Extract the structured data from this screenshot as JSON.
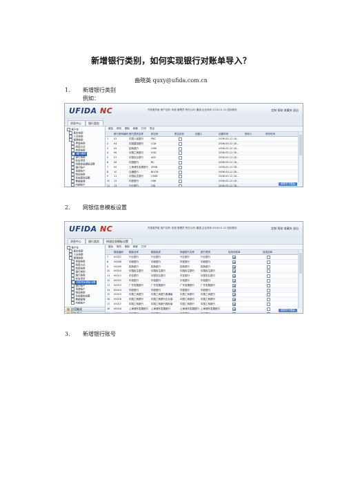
{
  "doc": {
    "title": "新增银行类别，如何实现银行对账单导入？",
    "author": "曲晓英    quxy@ufida.com.cn",
    "sections": [
      {
        "num": "1.",
        "label": "新增银行类别",
        "sub": "例如："
      },
      {
        "num": "2.",
        "label": "网银信息模板设置"
      },
      {
        "num": "3.",
        "label": "新增银行账号"
      }
    ]
  },
  "shot1": {
    "logo_a": "UFIDA ",
    "logo_b": "NC",
    "status": "开发维护组   用户名称: 系统    管理员    所在公司: 集团   企业时间 2018-01-12   回到首页",
    "tools": "定制  帮助  收藏夹  退出",
    "tabs": [
      "消息中心",
      "银行类别"
    ],
    "nav": [
      "客户化",
      "基本档案",
      "人员档案",
      "管理档案",
      "界面档案",
      "结算方式",
      "结算档案",
      "银行类别",
      "银行档案",
      "收支项目",
      "网银信息模板设置",
      "银行账户",
      "现金账户",
      "物品档案",
      "系统基础设置",
      "票据管理",
      "内部账户"
    ],
    "categories": [
      "应用集成",
      "财务会计",
      "计划预算",
      "资金管理",
      "供应链",
      "资产管理",
      "信息中心",
      "集成管理"
    ],
    "toolbar": [
      "增加",
      "修改",
      "删除",
      "刷新",
      "打印",
      "导出"
    ],
    "headers": [
      "",
      "银行类别编码",
      "银行类别名称",
      "助记码",
      "是否封存",
      "创建人",
      "创建时间",
      "修改人",
      "修改时间"
    ],
    "rows": [
      [
        "1",
        "02",
        "中国人民银行",
        "PBC",
        "",
        "",
        "2006-05-12 18...",
        ""
      ],
      [
        "2",
        "04",
        "中国建设银行",
        "CCB",
        "",
        "",
        "2006-05-12 18...",
        ""
      ],
      [
        "3",
        "05",
        "招商银行",
        "CMB",
        "",
        "",
        "2006-05-12 18...",
        ""
      ],
      [
        "4",
        "06",
        "中国工商银行",
        "ICBC",
        "",
        "",
        "2006-05-12 18...",
        ""
      ],
      [
        "5",
        "07",
        "中国农业银行",
        "ABC",
        "",
        "",
        "2006-05-12 18...",
        ""
      ],
      [
        "6",
        "08",
        "中国银行",
        "BC",
        "",
        "",
        "2006-05-12 18...",
        ""
      ],
      [
        "7",
        "09",
        "上海浦东发展银行",
        "SPDB",
        "",
        "",
        "2006-05-12 18...",
        ""
      ],
      [
        "8",
        "10",
        "交通银行",
        "BOCM",
        "",
        "",
        "2006-05-12 18...",
        ""
      ],
      [
        "9",
        "11",
        "中国民生银行",
        "CMBC",
        "",
        "",
        "2006-05-12 18...",
        ""
      ],
      [
        "10",
        "12",
        "华夏银行",
        "HXB",
        "",
        "",
        "2006-05-12 18...",
        ""
      ],
      [
        "11",
        "13",
        "兴业银行",
        "CIB",
        "",
        "",
        "2006-05-12 18...",
        ""
      ],
      [
        "12",
        "14",
        "日本瑞穗银行",
        "",
        "",
        "",
        "2006-05-12 18...",
        ""
      ],
      [
        "13",
        "15",
        "广东发展银行",
        "GDB",
        "",
        "",
        "2006-05-12 18...",
        ""
      ],
      [
        "14",
        "16",
        "北京银行",
        "BOB",
        "",
        "",
        "2006-05-12 18...",
        ""
      ],
      [
        "15",
        "17",
        "日本三菱银行",
        "",
        "",
        "",
        "2006-05-12 18...",
        ""
      ],
      [
        "16",
        "18",
        "国家开发银行",
        "CDB",
        "",
        "",
        "2006-05-12 18...",
        ""
      ],
      [
        "17",
        "19",
        "中信银行",
        "CNCB",
        "",
        "",
        "2006-05-12 18...",
        ""
      ],
      [
        "18",
        "20",
        "香港汇丰银行",
        "HSBC",
        "",
        "",
        "2006-05-12 18...",
        ""
      ],
      [
        "19",
        "99",
        "民生银行",
        "MSYH",
        "",
        "UE",
        "2018-01-12 08...",
        ""
      ],
      [
        "20",
        "9999",
        "其他银行",
        "OTHER",
        "",
        "",
        "2006-05-12 18...",
        ""
      ]
    ],
    "footer": "说明书下载后"
  },
  "shot2": {
    "logo_a": "UFIDA ",
    "logo_b": "NC",
    "status": "开发维护组   用户名称: 系统    管理员    所在公司: 集团   企业时间 2018-01-12   回到首页",
    "tools": "定制  帮助  收藏夹  退出",
    "tabs": [
      "消息中心",
      "银行类别",
      "网银信息模板设置"
    ],
    "nav": [
      "客户化",
      "基本档案",
      "人员档案",
      "管理档案",
      "界面档案",
      "结算方式",
      "结算档案",
      "银行类别",
      "银行档案",
      "收支项目",
      "网银信息模板设置",
      "银行账户",
      "现金账户",
      "物品档案",
      "系统基础设置",
      "票据管理",
      "内部账户"
    ],
    "categories": [
      "应用集成",
      "财务会计",
      "计划预算",
      "资金管理",
      "供应链",
      "资产管理",
      "信息中心",
      "集成管理"
    ],
    "toolbar": [
      "增加",
      "修改",
      "删除",
      "刷新",
      "打印"
    ],
    "headers": [
      "",
      "模板编码",
      "模板名称",
      "模板描述",
      "网银银行名称",
      "银行类别",
      "适用对账单",
      "适用回单"
    ],
    "rows": [
      [
        "7",
        "00007",
        "兴业银行",
        "兴业银行",
        "兴业银行",
        "兴业银行",
        "1",
        "0"
      ],
      [
        "8",
        "00008",
        "华夏银行",
        "华夏银行",
        "华夏银行",
        "华夏银行",
        "1",
        "0"
      ],
      [
        "9",
        "00009",
        "招商银行",
        "招商银行",
        "招商银行",
        "招商银行",
        "1",
        "0"
      ],
      [
        "10",
        "00010",
        "中国民生银行",
        "中国民生银行",
        "中国民生银行",
        "中国民生银行",
        "1",
        "0"
      ],
      [
        "11",
        "00011",
        "东亚银行",
        "中国农业银行",
        "东亚银行",
        "中国农业银行",
        "1",
        "0"
      ],
      [
        "12",
        "00012",
        "中信银行",
        "中信银行",
        "中信银行",
        "中信银行",
        "1",
        "0"
      ],
      [
        "13",
        "00013",
        "广东发展银行",
        "广东发展银行",
        "广东发展银行",
        "广东发展银行",
        "1",
        "0"
      ],
      [
        "14",
        "00014",
        "华夏银行",
        "华夏银行",
        "华夏银行",
        "华夏银行",
        "1",
        "0"
      ],
      [
        "15",
        "00015",
        "中国工商银行",
        "中国工商银行普通版",
        "中国工商银行",
        "中国工商银行",
        "1",
        "0"
      ],
      [
        "16",
        "00016",
        "中国工商银行",
        "中国工商银行企业版",
        "中国工商银行",
        "中国工商银行",
        "1",
        "0"
      ],
      [
        "17",
        "00017",
        "中国工商银行",
        "中国工商银行国际版",
        "中国工商银行",
        "中国工商银行",
        "1",
        "0"
      ],
      [
        "18",
        "00018",
        "上海浦东发展银行",
        "上海浦东发展银行",
        "上海浦东发展银行",
        "上海浦东发展银行",
        "1",
        "0"
      ],
      [
        "19",
        "00019",
        "浙商银行",
        "浙商银行",
        "浙商银行",
        "浙商银行",
        "1",
        "0"
      ],
      [
        "20",
        "00020",
        "日本瑞穗银行",
        "日本瑞穗银行",
        "日本瑞穗银行",
        "日本瑞穗银行",
        "1",
        "0"
      ],
      [
        "21",
        "00021",
        "日本瑞穗银行上海",
        "日本瑞穗银行上海",
        "日本瑞穗银行",
        "日本瑞穗银行",
        "1",
        "0"
      ],
      [
        "22",
        "00022",
        "日本瑞穗银行大连",
        "日本瑞穗银行大连",
        "日本瑞穗银行",
        "日本瑞穗银行",
        "1",
        "0"
      ],
      [
        "23",
        "00023",
        "日本三菱银行",
        "日本三菱银行",
        "日本三菱银行",
        "日本三菱银行",
        "1",
        "0"
      ],
      [
        "24",
        "9901",
        "民生银行网银模板",
        "民生银行网银模板",
        "民生银行网银",
        "民生银行",
        "1",
        "0"
      ]
    ],
    "footer": "说明书下载后"
  }
}
